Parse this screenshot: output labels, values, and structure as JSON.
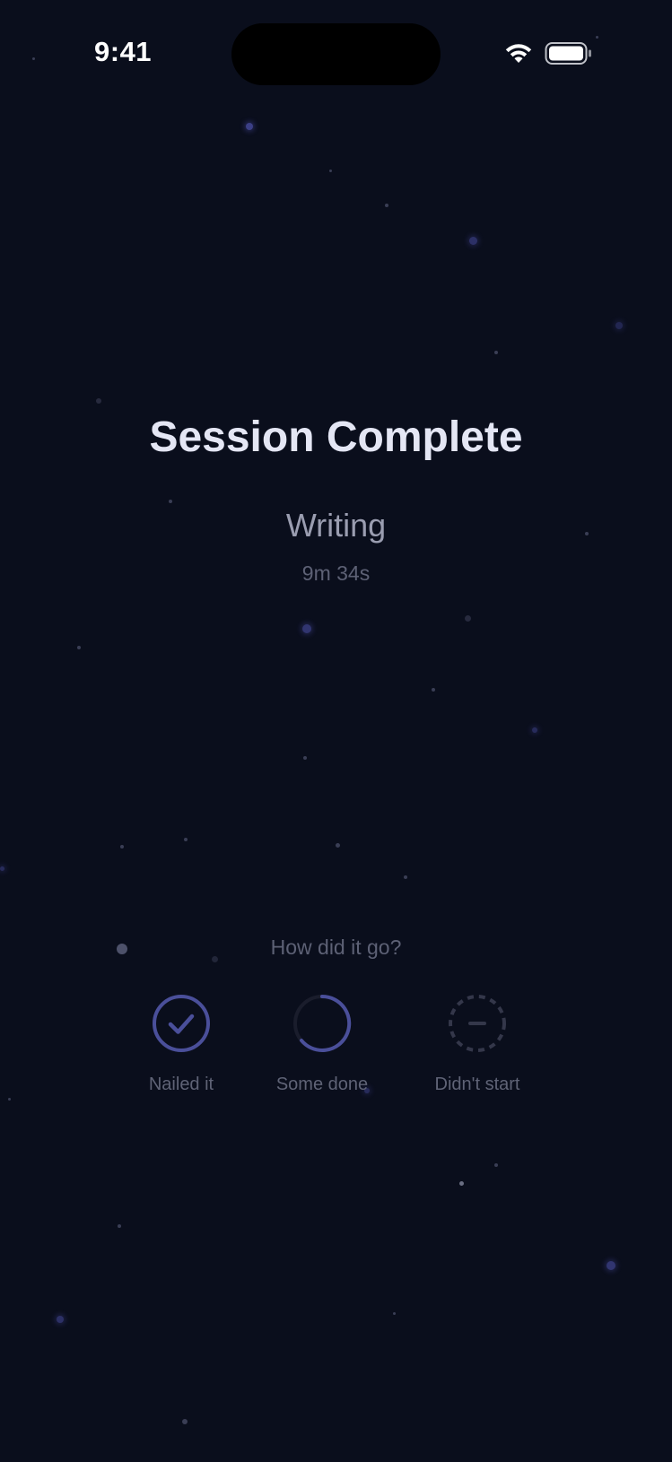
{
  "status_bar": {
    "time": "9:41",
    "wifi_icon": "wifi-icon",
    "battery_icon": "battery-icon"
  },
  "session": {
    "title": "Session Complete",
    "category": "Writing",
    "duration": "9m 34s"
  },
  "feedback": {
    "prompt": "How did it go?",
    "options": [
      {
        "label": "Nailed it",
        "icon": "check-circle-icon",
        "color": "#4a4f9a"
      },
      {
        "label": "Some done",
        "icon": "partial-circle-icon",
        "color": "#4a4f9a"
      },
      {
        "label": "Didn't start",
        "icon": "dashed-minus-circle-icon",
        "color": "#3a3d4f"
      }
    ]
  },
  "colors": {
    "background": "#0a0e1c",
    "accent": "#4a4f9a",
    "title": "#e4e6f4",
    "muted": "#5d6175"
  }
}
